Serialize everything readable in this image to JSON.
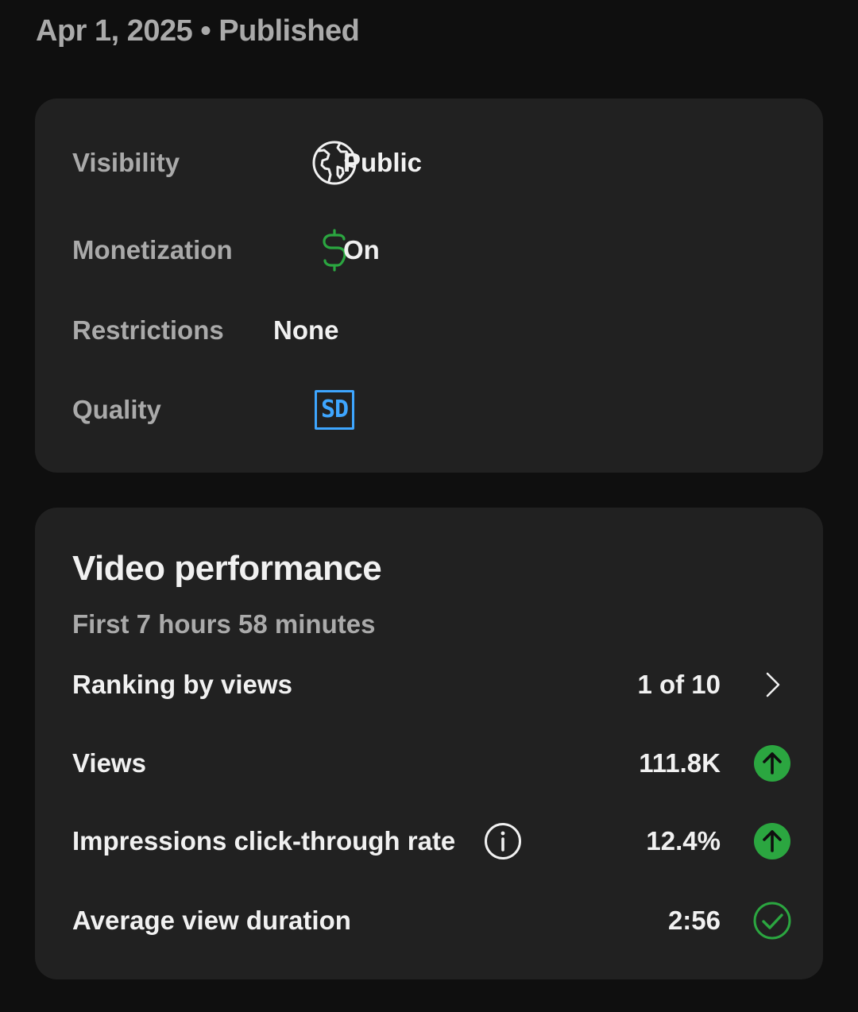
{
  "header": {
    "date": "Apr 1, 2025",
    "separator": "•",
    "status": "Published"
  },
  "details": {
    "visibility": {
      "label": "Visibility",
      "icon": "globe-icon",
      "value": "Public"
    },
    "monetization": {
      "label": "Monetization",
      "icon": "dollar-icon",
      "value": "On",
      "icon_color": "#2ba640"
    },
    "restrictions": {
      "label": "Restrictions",
      "value": "None"
    },
    "quality": {
      "label": "Quality",
      "badge": "SD",
      "badge_color": "#3ea6ff"
    }
  },
  "performance": {
    "title": "Video performance",
    "subtitle": "First 7 hours 58 minutes",
    "rows": [
      {
        "label": "Ranking by views",
        "value": "1 of 10",
        "indicator": "chevron-right-icon"
      },
      {
        "label": "Views",
        "value": "111.8K",
        "indicator": "arrow-up-circle-icon"
      },
      {
        "label": "Impressions click-through rate",
        "value": "12.4%",
        "indicator": "arrow-up-circle-icon",
        "info": "info-icon"
      },
      {
        "label": "Average view duration",
        "value": "2:56",
        "indicator": "check-circle-icon"
      }
    ],
    "colors": {
      "positive": "#2ba640",
      "text": "#f1f1f1",
      "secondary": "#aaaaaa"
    }
  }
}
